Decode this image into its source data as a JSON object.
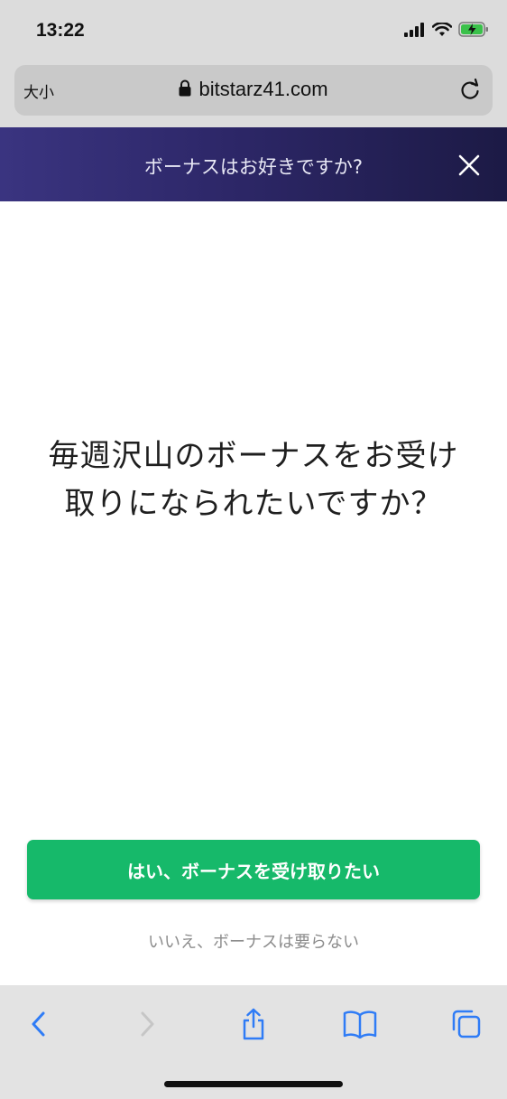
{
  "status_bar": {
    "time": "13:22"
  },
  "browser": {
    "text_size_label": "大小",
    "url": "bitstarz41.com"
  },
  "banner": {
    "title": "ボーナスはお好きですか?"
  },
  "main": {
    "question": "毎週沢山のボーナスをお受け取りになられたいですか？",
    "yes_button_label": "はい、ボーナスを受け取りたい",
    "no_link_label": "いいえ、ボーナスは要らない"
  },
  "colors": {
    "banner_start": "#3a3480",
    "banner_end": "#1c1a45",
    "accent_green": "#16b96a",
    "toolbar_icon_blue": "#2f7cf6"
  },
  "toolbar": {
    "icons": [
      "back-icon",
      "forward-icon",
      "share-icon",
      "bookmarks-icon",
      "tabs-icon"
    ]
  }
}
